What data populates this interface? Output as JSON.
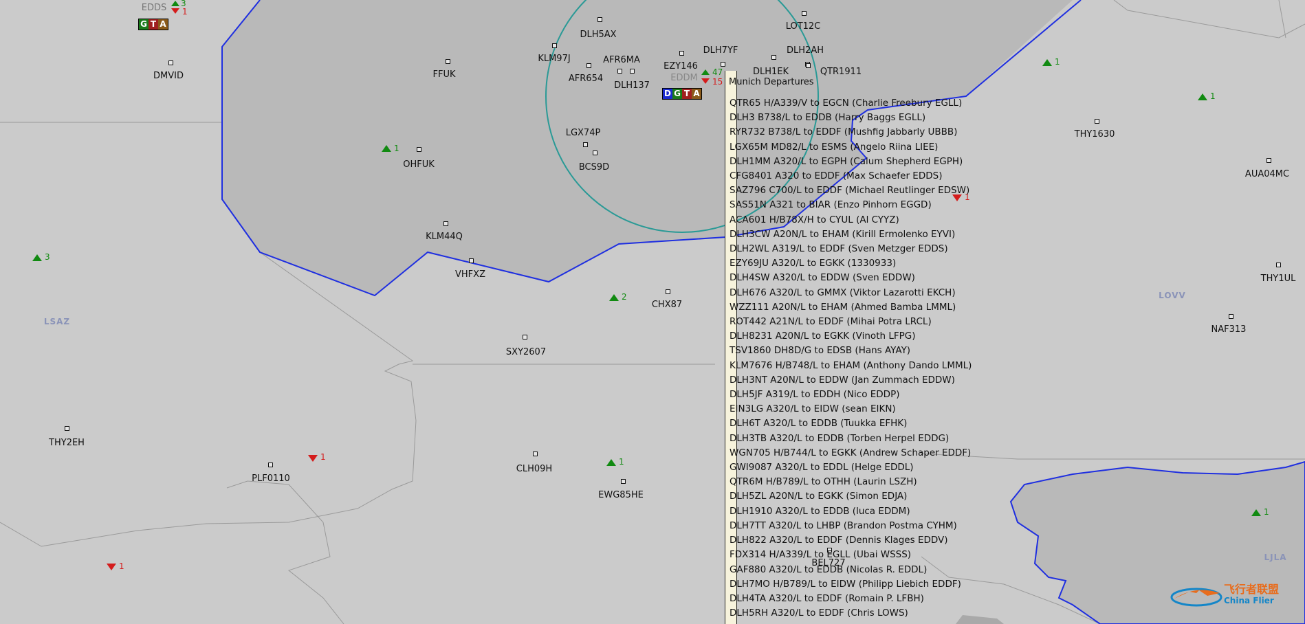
{
  "map": {
    "sector_labels": [
      "LSAZ",
      "LOVV",
      "LJLA"
    ],
    "aircraft": [
      "DMVID",
      "FFUK",
      "DLH5AX",
      "KLM97J",
      "AFR6MA",
      "AFR654",
      "DLH137",
      "EZY146",
      "DLH7YF",
      "LOT12C",
      "DLH2AH",
      "QTR1911",
      "DLH1EK",
      "OHFUK",
      "LGX74P",
      "BCS9D",
      "KLM44Q",
      "VHFXZ",
      "CHX87",
      "SXY2607",
      "THY2EH",
      "PLF0110",
      "CLH09H",
      "EWG85HE",
      "THY1630",
      "AUA04MC",
      "THY1UL",
      "NAF313",
      "BEL727"
    ],
    "airport_counts": {
      "edds_name": "EDDS",
      "edds_up": "3",
      "edds_down": "1",
      "eddm_name": "EDDM",
      "eddm_up": "47",
      "eddm_down": "15",
      "t_ohfuk": "1",
      "t_lsaz": "3",
      "t_chx": "2",
      "t_clh": "1",
      "t_thy1630": "1",
      "t_thy1630b": "1",
      "t_right_down": "1",
      "t_plf": "1",
      "t_bottom_left": "1",
      "t_lj": "1"
    },
    "gta_box": [
      "G",
      "T",
      "A"
    ],
    "dgta_box": [
      "D",
      "G",
      "T",
      "A"
    ]
  },
  "departures": {
    "title": "Munich Departures",
    "rows": [
      "QTR65 H/A339/V to EGCN (Charlie Freebury EGLL)",
      "DLH3 B738/L to EDDB (Harry Baggs EGLL)",
      "RYR732 B738/L to EDDF (Mushfig Jabbarly UBBB)",
      "LGX65M MD82/L to ESMS (Angelo Riina LIEE)",
      "DLH1MM A320/L to EGPH (Calum Shepherd EGPH)",
      "CFG8401 A320 to EDDF (Max Schaefer EDDS)",
      "SAZ796 C700/L to EDDF (Michael Reutlinger EDSW)",
      "SAS51N A321 to BIAR (Enzo Pinhorn EGGD)",
      "ACA601 H/B78X/H to CYUL (Al CYYZ)",
      "DLH3CW A20N/L to EHAM (Kirill Ermolenko EYVI)",
      "DLH2WL A319/L to EDDF (Sven Metzger EDDS)",
      "EZY69JU A320/L to EGKK (1330933)",
      "DLH4SW A320/L to EDDW (Sven EDDW)",
      "DLH676 A320/L to GMMX (Viktor Lazarotti EKCH)",
      "WZZ111 A20N/L to EHAM (Ahmed Bamba LMML)",
      "ROT442 A21N/L to EDDF (Mihai Potra LRCL)",
      "DLH8231 A20N/L to EGKK (Vinoth LFPG)",
      "TSV1860 DH8D/G to EDSB (Hans AYAY)",
      "KLM7676 H/B748/L to EHAM (Anthony Dando LMML)",
      "DLH3NT A20N/L to EDDW (Jan Zummach EDDW)",
      "DLH5JF A319/L to EDDH (Nico EDDP)",
      "EIN3LG A320/L to EIDW (sean EIKN)",
      "DLH6T A320/L to EDDB (Tuukka EFHK)",
      "DLH3TB A320/L to EDDB (Torben Herpel EDDG)",
      "WGN705 H/B744/L to EGKK (Andrew Schaper EDDF)",
      "GWI9087 A320/L to EDDL (Helge EDDL)",
      "QTR6M H/B789/L to OTHH (Laurin LSZH)",
      "DLH5ZL A20N/L to EGKK (Simon EDJA)",
      "DLH1910 A320/L to EDDB (luca EDDM)",
      "DLH7TT A320/L to LHBP (Brandon Postma CYHM)",
      "DLH822 A320/L to EDDF (Dennis Klages EDDV)",
      "FDX314 H/A339/L to EGLL (Ubai WSSS)",
      "GAF880 A320/L to EDDB (Nicolas R. EDDL)",
      "DLH7MO H/B789/L to EIDW (Philipp Liebich EDDF)",
      "DLH4TA A320/L to EDDF (Romain P. LFBH)",
      "DLH5RH A320/L to EDDF (Chris LOWS)"
    ]
  },
  "watermark": {
    "cn": "飞行者联盟",
    "en": "China Flier"
  },
  "colors": {
    "background": "#cbcbcb",
    "tma_fill": "#b9b9b9",
    "sector_line": "#1f2fe0",
    "ctr_circle": "#2a9a96",
    "panel": "#f7f3dc"
  }
}
